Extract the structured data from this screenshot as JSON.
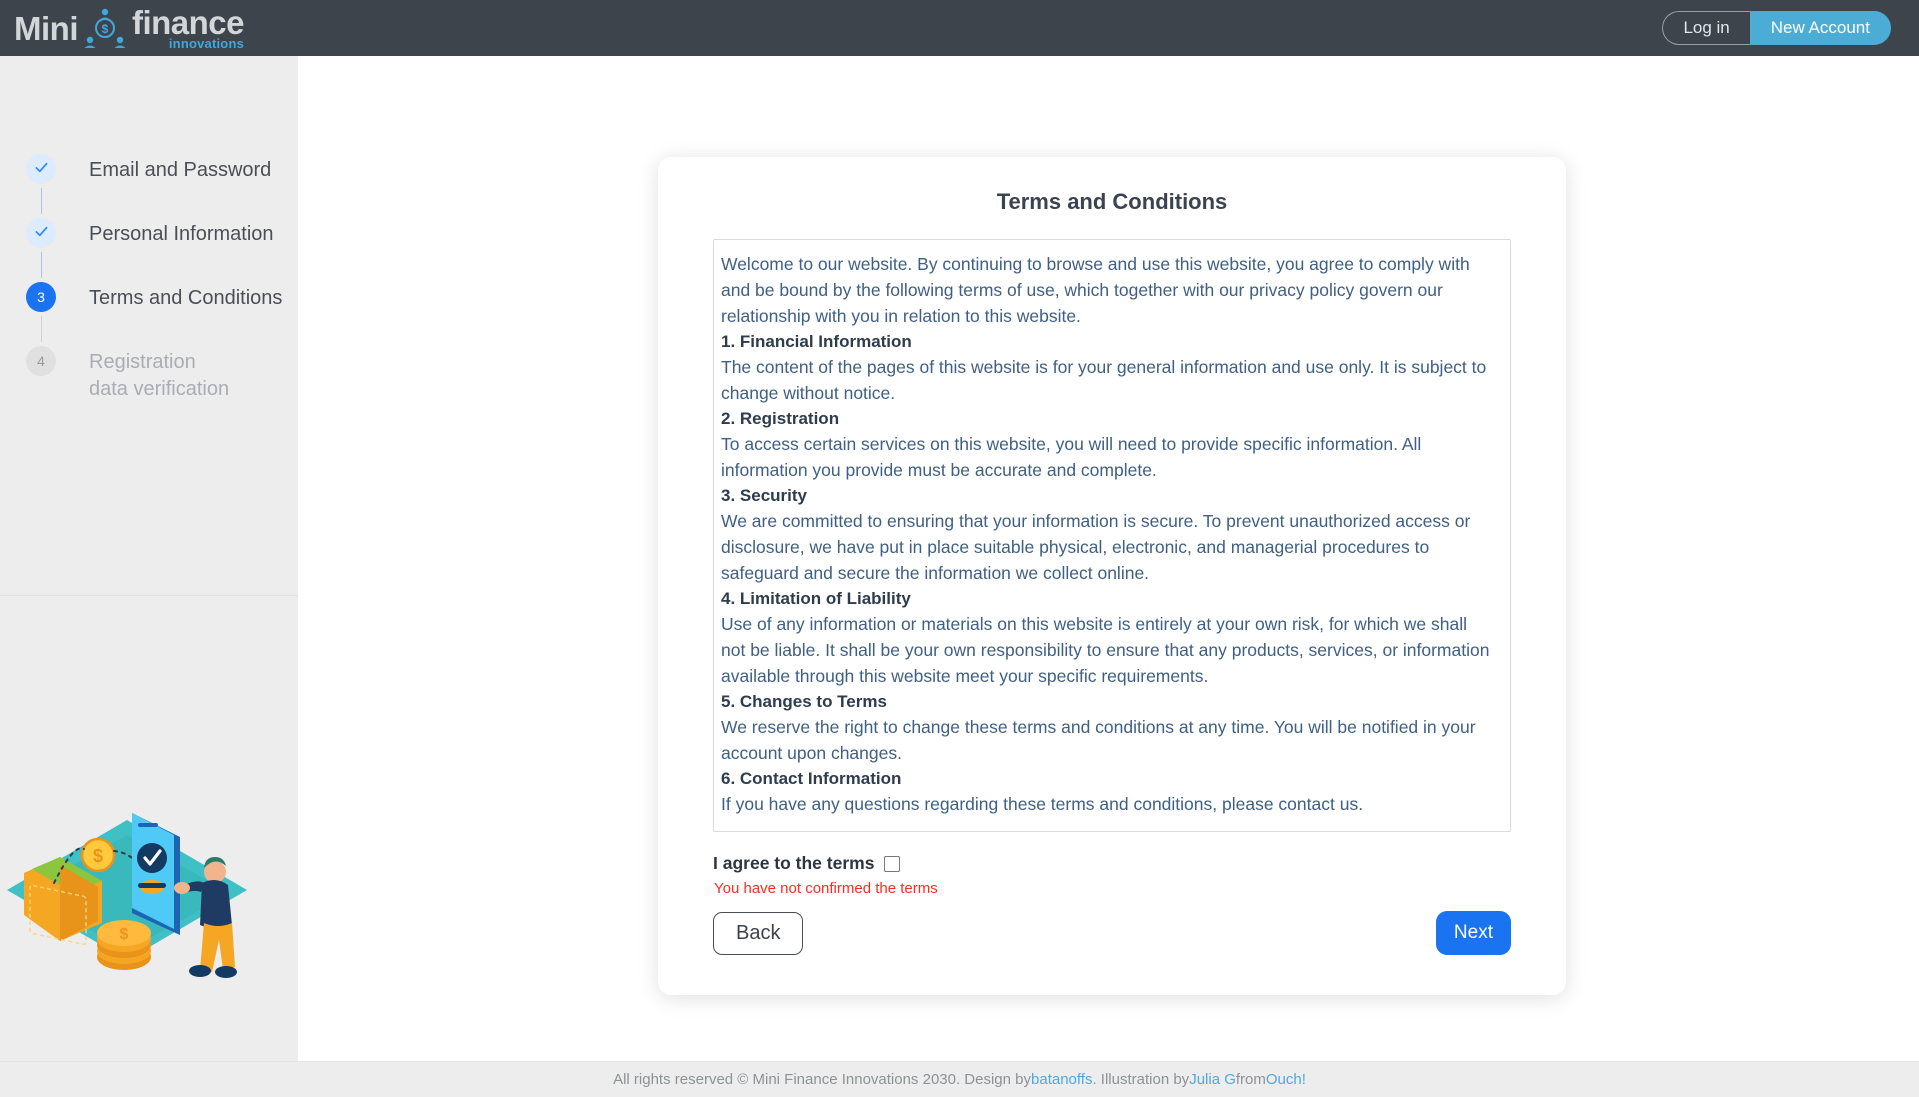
{
  "header": {
    "logo": {
      "word1": "Mini",
      "word2": "finance",
      "tagline": "innovations",
      "icon": "money-people-icon"
    },
    "login_label": "Log in",
    "new_account_label": "New Account"
  },
  "sidebar": {
    "steps": [
      {
        "marker": "✓",
        "state": "done",
        "label": "Email and Password"
      },
      {
        "marker": "✓",
        "state": "done",
        "label": "Personal Information"
      },
      {
        "marker": "3",
        "state": "current",
        "label": "Terms and Conditions"
      },
      {
        "marker": "4",
        "state": "todo",
        "label": "Registration\ndata verification"
      }
    ],
    "illustration_alt": "wallet-phone-coins-illustration"
  },
  "main": {
    "card_title": "Terms and Conditions",
    "terms": [
      {
        "type": "para",
        "text": "Welcome to our website. By continuing to browse and use this website, you agree to comply with and be bound by the following terms of use, which together with our privacy policy govern our relationship with you in relation to this website."
      },
      {
        "type": "heading",
        "text": "1. Financial Information"
      },
      {
        "type": "para",
        "text": "The content of the pages of this website is for your general information and use only. It is subject to change without notice."
      },
      {
        "type": "heading",
        "text": "2. Registration"
      },
      {
        "type": "para",
        "text": "To access certain services on this website, you will need to provide specific information. All information you provide must be accurate and complete."
      },
      {
        "type": "heading",
        "text": "3. Security"
      },
      {
        "type": "para",
        "text": "We are committed to ensuring that your information is secure. To prevent unauthorized access or disclosure, we have put in place suitable physical, electronic, and managerial procedures to safeguard and secure the information we collect online."
      },
      {
        "type": "heading",
        "text": "4. Limitation of Liability"
      },
      {
        "type": "para",
        "text": "Use of any information or materials on this website is entirely at your own risk, for which we shall not be liable. It shall be your own responsibility to ensure that any products, services, or information available through this website meet your specific requirements."
      },
      {
        "type": "heading",
        "text": "5. Changes to Terms"
      },
      {
        "type": "para",
        "text": "We reserve the right to change these terms and conditions at any time. You will be notified in your account upon changes."
      },
      {
        "type": "heading",
        "text": "6. Contact Information"
      },
      {
        "type": "para",
        "text": "If you have any questions regarding these terms and conditions, please contact us."
      }
    ],
    "agree_label": "I agree to the terms",
    "agree_checked": false,
    "error_message": "You have not confirmed the terms",
    "back_label": "Back",
    "next_label": "Next"
  },
  "footer": {
    "text_start": "All rights reserved © Mini Finance Innovations 2030. Design by ",
    "link1": "batanoffs",
    "text_mid": ". Illustration by ",
    "link2": "Julia G",
    "text_mid2": " from ",
    "link3": "Ouch!"
  },
  "colors": {
    "header_bg": "#3e444c",
    "accent_blue": "#1a73f0",
    "logo_blue": "#3fa9dd",
    "button_blue": "#4badd6",
    "error_red": "#ff2b23",
    "sidebar_bg": "#ededed",
    "body_text": "#3f6084"
  }
}
